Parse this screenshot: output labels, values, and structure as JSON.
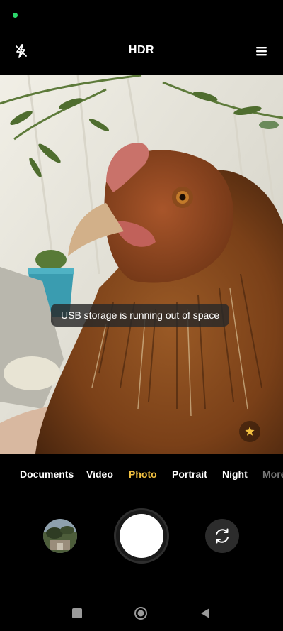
{
  "status_bar": {
    "indicator_color": "#2bd76b"
  },
  "top_bar": {
    "flash_icon": "flash-off-icon",
    "hdr_label": "HDR",
    "menu_icon": "menu-icon"
  },
  "viewfinder": {
    "subject": "chicken-preview",
    "toast_text": "USB storage is running out of space",
    "ai_icon": "ai-scene-icon"
  },
  "modes": {
    "items": [
      "Documents",
      "Video",
      "Photo",
      "Portrait",
      "Night",
      "More"
    ],
    "active": "Photo",
    "accent_color": "#f2c141"
  },
  "controls": {
    "gallery_icon": "gallery-thumbnail",
    "shutter_icon": "shutter-icon",
    "switch_icon": "switch-camera-icon"
  },
  "nav_bar": {
    "recents_icon": "recents-icon",
    "home_icon": "home-icon",
    "back_icon": "back-icon"
  }
}
